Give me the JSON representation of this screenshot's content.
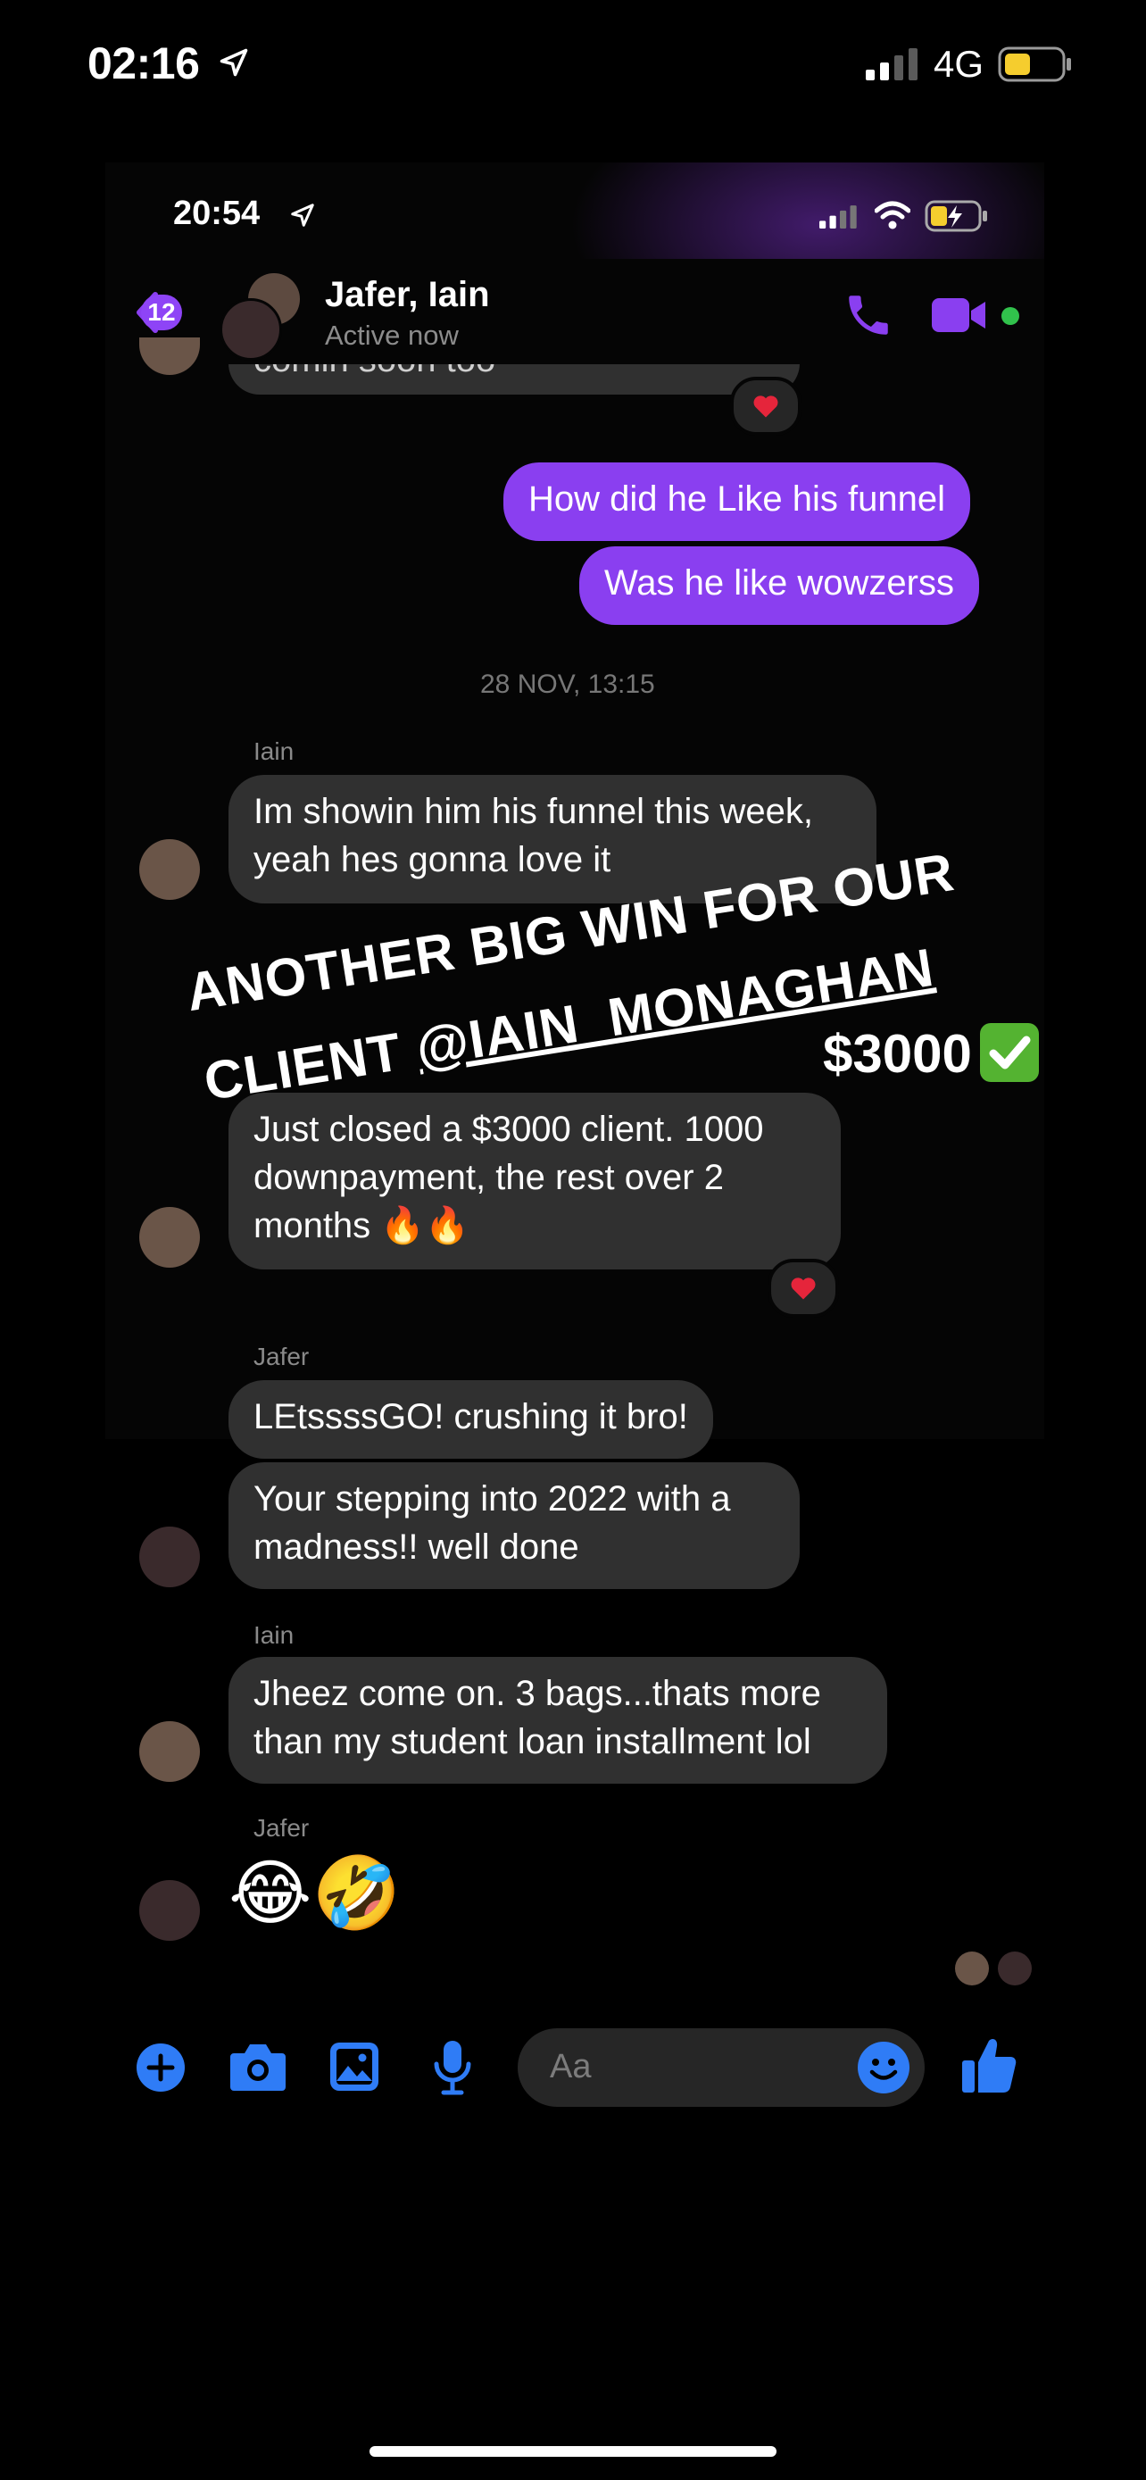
{
  "status_bar": {
    "time": "02:16",
    "network": "4G"
  },
  "inner_status_bar": {
    "time": "20:54"
  },
  "chat_header": {
    "back_badge": "12",
    "title": "Jafer, Iain",
    "status": "Active now"
  },
  "messages": {
    "top_partial": "comin soon too",
    "out_1": "How did he Like his funnel",
    "out_2": "Was he like wowzerss",
    "date_1": "28 NOV, 13:15",
    "sender_iain_1": "Iain",
    "iain_1": "Im showin him his funnel this week, yeah hes gonna love it",
    "iain_2": "Just closed a $3000 client. 1000 downpayment, the rest over 2 months 🔥🔥",
    "sender_jafer_1": "Jafer",
    "jafer_1": "LEtssssGO! crushing it bro!",
    "jafer_2": "Your stepping into 2022 with a madness!! well done",
    "sender_iain_2": "Iain",
    "iain_3": "Jheez come on. 3 bags...thats more than my student loan installment lol",
    "sender_jafer_2": "Jafer",
    "jafer_emojis": "😂🤣"
  },
  "overlay": {
    "line1": "ANOTHER BIG WIN FOR OUR",
    "line2_prefix": "CLIENT ",
    "line2_handle": "@IAIN_MONAGHAN",
    "amount": "$3000"
  },
  "composer": {
    "placeholder": "Aa"
  },
  "icons": [
    "location-arrow-icon",
    "signal-icon",
    "wifi-icon",
    "battery-icon",
    "phone-icon",
    "video-icon",
    "plus-icon",
    "camera-icon",
    "gallery-icon",
    "microphone-icon",
    "emoji-icon",
    "thumbs-up-icon",
    "heart-icon",
    "check-mark-icon"
  ],
  "colors": {
    "accent": "#8a3ff0",
    "messenger_blue": "#2f7cf6",
    "online": "#31c24c",
    "battery": "#f5cd2e"
  }
}
